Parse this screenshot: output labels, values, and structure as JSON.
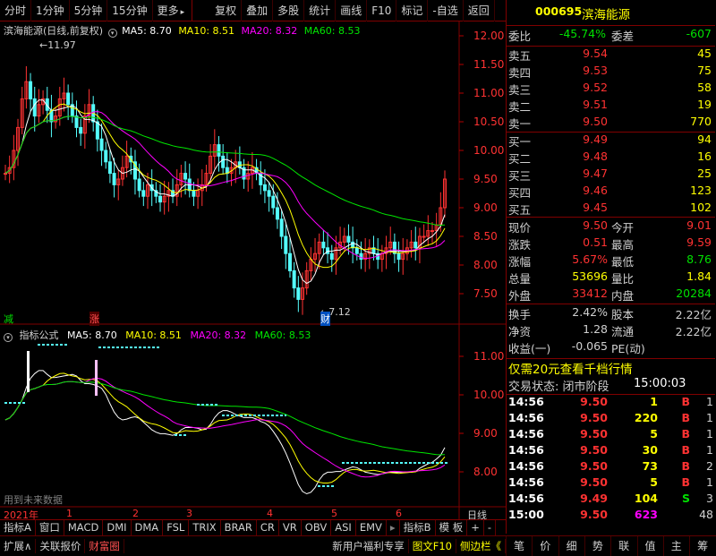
{
  "toolbar": {
    "period_items": [
      "分时",
      "1分钟",
      "5分钟",
      "15分钟",
      "更多"
    ],
    "more_arrow": "▸",
    "action_items": [
      "复权",
      "叠加",
      "多股",
      "统计",
      "画线",
      "F10",
      "标记",
      "-自选",
      "返回"
    ]
  },
  "main_chart": {
    "stock_title": "滨海能源(日线,前复权)",
    "ma5": "MA5: 8.70",
    "ma10": "MA10: 8.51",
    "ma20": "MA20: 8.32",
    "ma60": "MA60: 8.53",
    "high_label": "11.97",
    "low_label": "7.12",
    "jian_mark": "减",
    "zhang_mark": "涨",
    "cai_mark": "财",
    "price_axis": [
      "12.00",
      "11.50",
      "11.00",
      "10.50",
      "10.00",
      "9.50",
      "9.00",
      "8.50",
      "8.00",
      "7.50"
    ]
  },
  "indicator": {
    "title": "指标公式",
    "ma5": "MA5: 8.70",
    "ma10": "MA10: 8.51",
    "ma20": "MA20: 8.32",
    "ma60": "MA60: 8.53",
    "axis": [
      "11.00",
      "10.00",
      "9.00",
      "8.00"
    ],
    "warning": "用到未来数据"
  },
  "date_axis": {
    "year": "2021年",
    "months": [
      "1",
      "2",
      "3",
      "4",
      "5",
      "6"
    ],
    "right_label": "日线"
  },
  "tabs": [
    "指标A",
    "窗口",
    "MACD",
    "DMI",
    "DMA",
    "FSL",
    "TRIX",
    "BRAR",
    "CR",
    "VR",
    "OBV",
    "ASI",
    "EMV",
    "指标B",
    "模 板",
    "+",
    "-"
  ],
  "status_bar": {
    "left": [
      "扩展∧",
      "关联报价",
      "财富圈"
    ],
    "promo": "新用户福利专享",
    "f10": "图文F10",
    "sidebar": "侧边栏《",
    "right_buttons": [
      "笔",
      "价",
      "细",
      "势",
      "联",
      "值",
      "主",
      "筹"
    ]
  },
  "quote": {
    "code": "000695",
    "name": "滨海能源",
    "weibi_label": "委比",
    "weibi_value": "-45.74%",
    "weicha_label": "委差",
    "weicha_value": "-607",
    "asks": [
      {
        "label": "卖五",
        "price": "9.54",
        "vol": "45"
      },
      {
        "label": "卖四",
        "price": "9.53",
        "vol": "75"
      },
      {
        "label": "卖三",
        "price": "9.52",
        "vol": "58"
      },
      {
        "label": "卖二",
        "price": "9.51",
        "vol": "19"
      },
      {
        "label": "卖一",
        "price": "9.50",
        "vol": "770"
      }
    ],
    "bids": [
      {
        "label": "买一",
        "price": "9.49",
        "vol": "94"
      },
      {
        "label": "买二",
        "price": "9.48",
        "vol": "16"
      },
      {
        "label": "买三",
        "price": "9.47",
        "vol": "25"
      },
      {
        "label": "买四",
        "price": "9.46",
        "vol": "123"
      },
      {
        "label": "买五",
        "price": "9.45",
        "vol": "102"
      }
    ],
    "stats": [
      {
        "l1": "现价",
        "v1": "9.50",
        "l2": "今开",
        "v2": "9.01"
      },
      {
        "l1": "涨跌",
        "v1": "0.51",
        "l2": "最高",
        "v2": "9.59"
      },
      {
        "l1": "涨幅",
        "v1": "5.67%",
        "l2": "最低",
        "v2": "8.76"
      },
      {
        "l1": "总量",
        "v1": "53696",
        "l2": "量比",
        "v2": "1.84"
      },
      {
        "l1": "外盘",
        "v1": "33412",
        "l2": "内盘",
        "v2": "20284"
      }
    ],
    "stats2": [
      {
        "l1": "换手",
        "v1": "2.42%",
        "l2": "股本",
        "v2": "2.22亿"
      },
      {
        "l1": "净资",
        "v1": "1.28",
        "l2": "流通",
        "v2": "2.22亿"
      },
      {
        "l1": "收益(一)",
        "v1": "-0.065",
        "l2": "PE(动)",
        "v2": ""
      }
    ],
    "promo": "仅需20元查看千档行情",
    "trade_status": "交易状态: 闭市阶段",
    "trade_time": "15:00:03",
    "ticks": [
      {
        "t": "14:56",
        "p": "9.50",
        "v": "1",
        "d": "B",
        "n": "1"
      },
      {
        "t": "14:56",
        "p": "9.50",
        "v": "220",
        "d": "B",
        "n": "1"
      },
      {
        "t": "14:56",
        "p": "9.50",
        "v": "5",
        "d": "B",
        "n": "1"
      },
      {
        "t": "14:56",
        "p": "9.50",
        "v": "30",
        "d": "B",
        "n": "1"
      },
      {
        "t": "14:56",
        "p": "9.50",
        "v": "73",
        "d": "B",
        "n": "2"
      },
      {
        "t": "14:56",
        "p": "9.50",
        "v": "5",
        "d": "B",
        "n": "1"
      },
      {
        "t": "14:56",
        "p": "9.49",
        "v": "104",
        "d": "S",
        "n": "3"
      },
      {
        "t": "15:00",
        "p": "9.50",
        "v": "623",
        "d": "",
        "n": "48"
      }
    ]
  },
  "colors": {
    "up": "#ff3232",
    "down": "#54fcfc",
    "ma5": "#ffffff",
    "ma10": "#ffff00",
    "ma20": "#ff00ff",
    "ma60": "#00e600",
    "border": "#800000",
    "yellow": "#ffff00"
  }
}
